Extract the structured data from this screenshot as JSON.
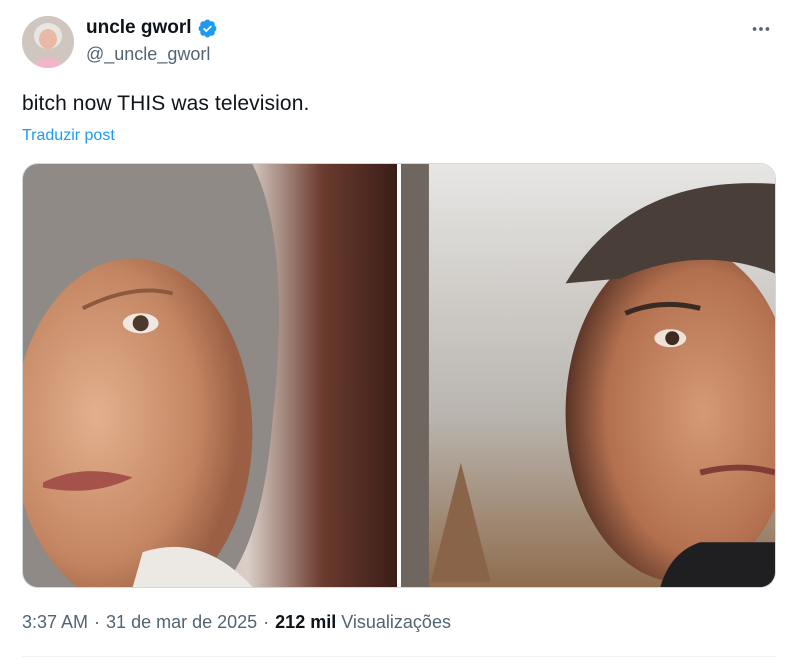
{
  "author": {
    "display_name": "uncle gworl",
    "handle": "@_uncle_gworl",
    "verified": true,
    "verified_color": "#1d9bf0",
    "avatar_icon": "avatar-photo"
  },
  "more_icon": "more-options-icon",
  "tweet": {
    "text": "bitch now THIS was television.",
    "translate_label": "Traduzir post"
  },
  "media": [
    {
      "icon": "photo-woman-closeup"
    },
    {
      "icon": "photo-man-closeup"
    }
  ],
  "meta": {
    "time": "3:37 AM",
    "separator": "·",
    "date": "31 de mar de 2025",
    "views_count": "212 mil",
    "views_label": "Visualizações"
  },
  "colors": {
    "text": "#0f1419",
    "secondary": "#536471",
    "link": "#1d9bf0",
    "border": "#cfd9de"
  }
}
